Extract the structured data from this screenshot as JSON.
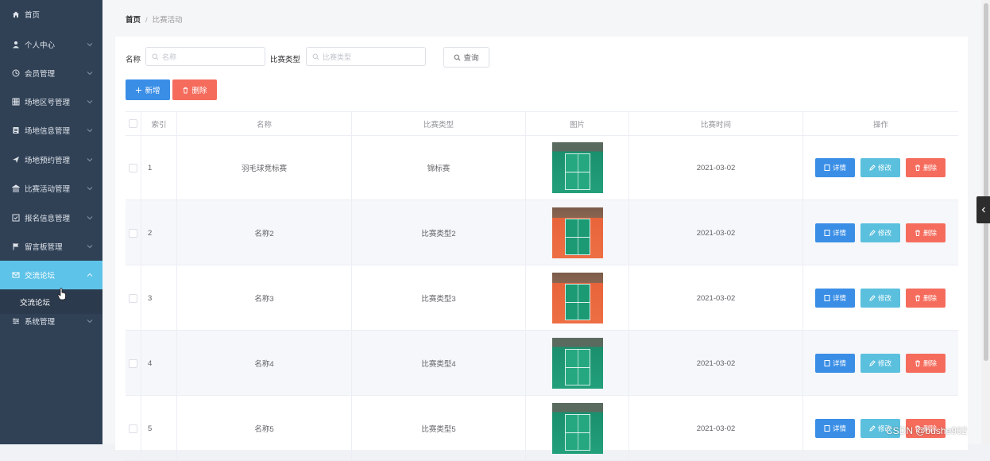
{
  "sidebar": {
    "items": [
      {
        "label": "首页",
        "icon": "home-icon"
      },
      {
        "label": "个人中心",
        "icon": "user-icon"
      },
      {
        "label": "会员管理",
        "icon": "clock-icon"
      },
      {
        "label": "场地区号管理",
        "icon": "grid-icon"
      },
      {
        "label": "场地信息管理",
        "icon": "doc-icon"
      },
      {
        "label": "场地预约管理",
        "icon": "send-icon"
      },
      {
        "label": "比赛活动管理",
        "icon": "bank-icon"
      },
      {
        "label": "报名信息管理",
        "icon": "checkbox-icon"
      },
      {
        "label": "留言板管理",
        "icon": "flag-icon"
      },
      {
        "label": "交流论坛",
        "icon": "mail-icon"
      },
      {
        "label": "系统管理",
        "icon": "settings-icon"
      }
    ],
    "submenu": {
      "label": "交流论坛"
    },
    "active_color": "#5ec3e8"
  },
  "breadcrumb": {
    "home": "首页",
    "current": "比赛活动"
  },
  "search": {
    "name_label": "名称",
    "name_placeholder": "名称",
    "type_label": "比赛类型",
    "type_placeholder": "比赛类型",
    "query_label": "查询"
  },
  "toolbar": {
    "add_label": "新增",
    "delete_label": "删除"
  },
  "table": {
    "headers": [
      "索引",
      "名称",
      "比赛类型",
      "图片",
      "比赛时间",
      "操作"
    ],
    "rows": [
      {
        "index": "1",
        "name": "羽毛球竞标赛",
        "type": "锦标赛",
        "image": "green",
        "time": "2021-03-02"
      },
      {
        "index": "2",
        "name": "名称2",
        "type": "比赛类型2",
        "image": "orange",
        "time": "2021-03-02"
      },
      {
        "index": "3",
        "name": "名称3",
        "type": "比赛类型3",
        "image": "orange",
        "time": "2021-03-02"
      },
      {
        "index": "4",
        "name": "名称4",
        "type": "比赛类型4",
        "image": "green",
        "time": "2021-03-02"
      },
      {
        "index": "5",
        "name": "名称5",
        "type": "比赛类型5",
        "image": "green",
        "time": "2021-03-02"
      }
    ],
    "actions": {
      "detail": "详情",
      "edit": "修改",
      "remove": "删除"
    }
  },
  "watermark": "CSDN @bushe902"
}
